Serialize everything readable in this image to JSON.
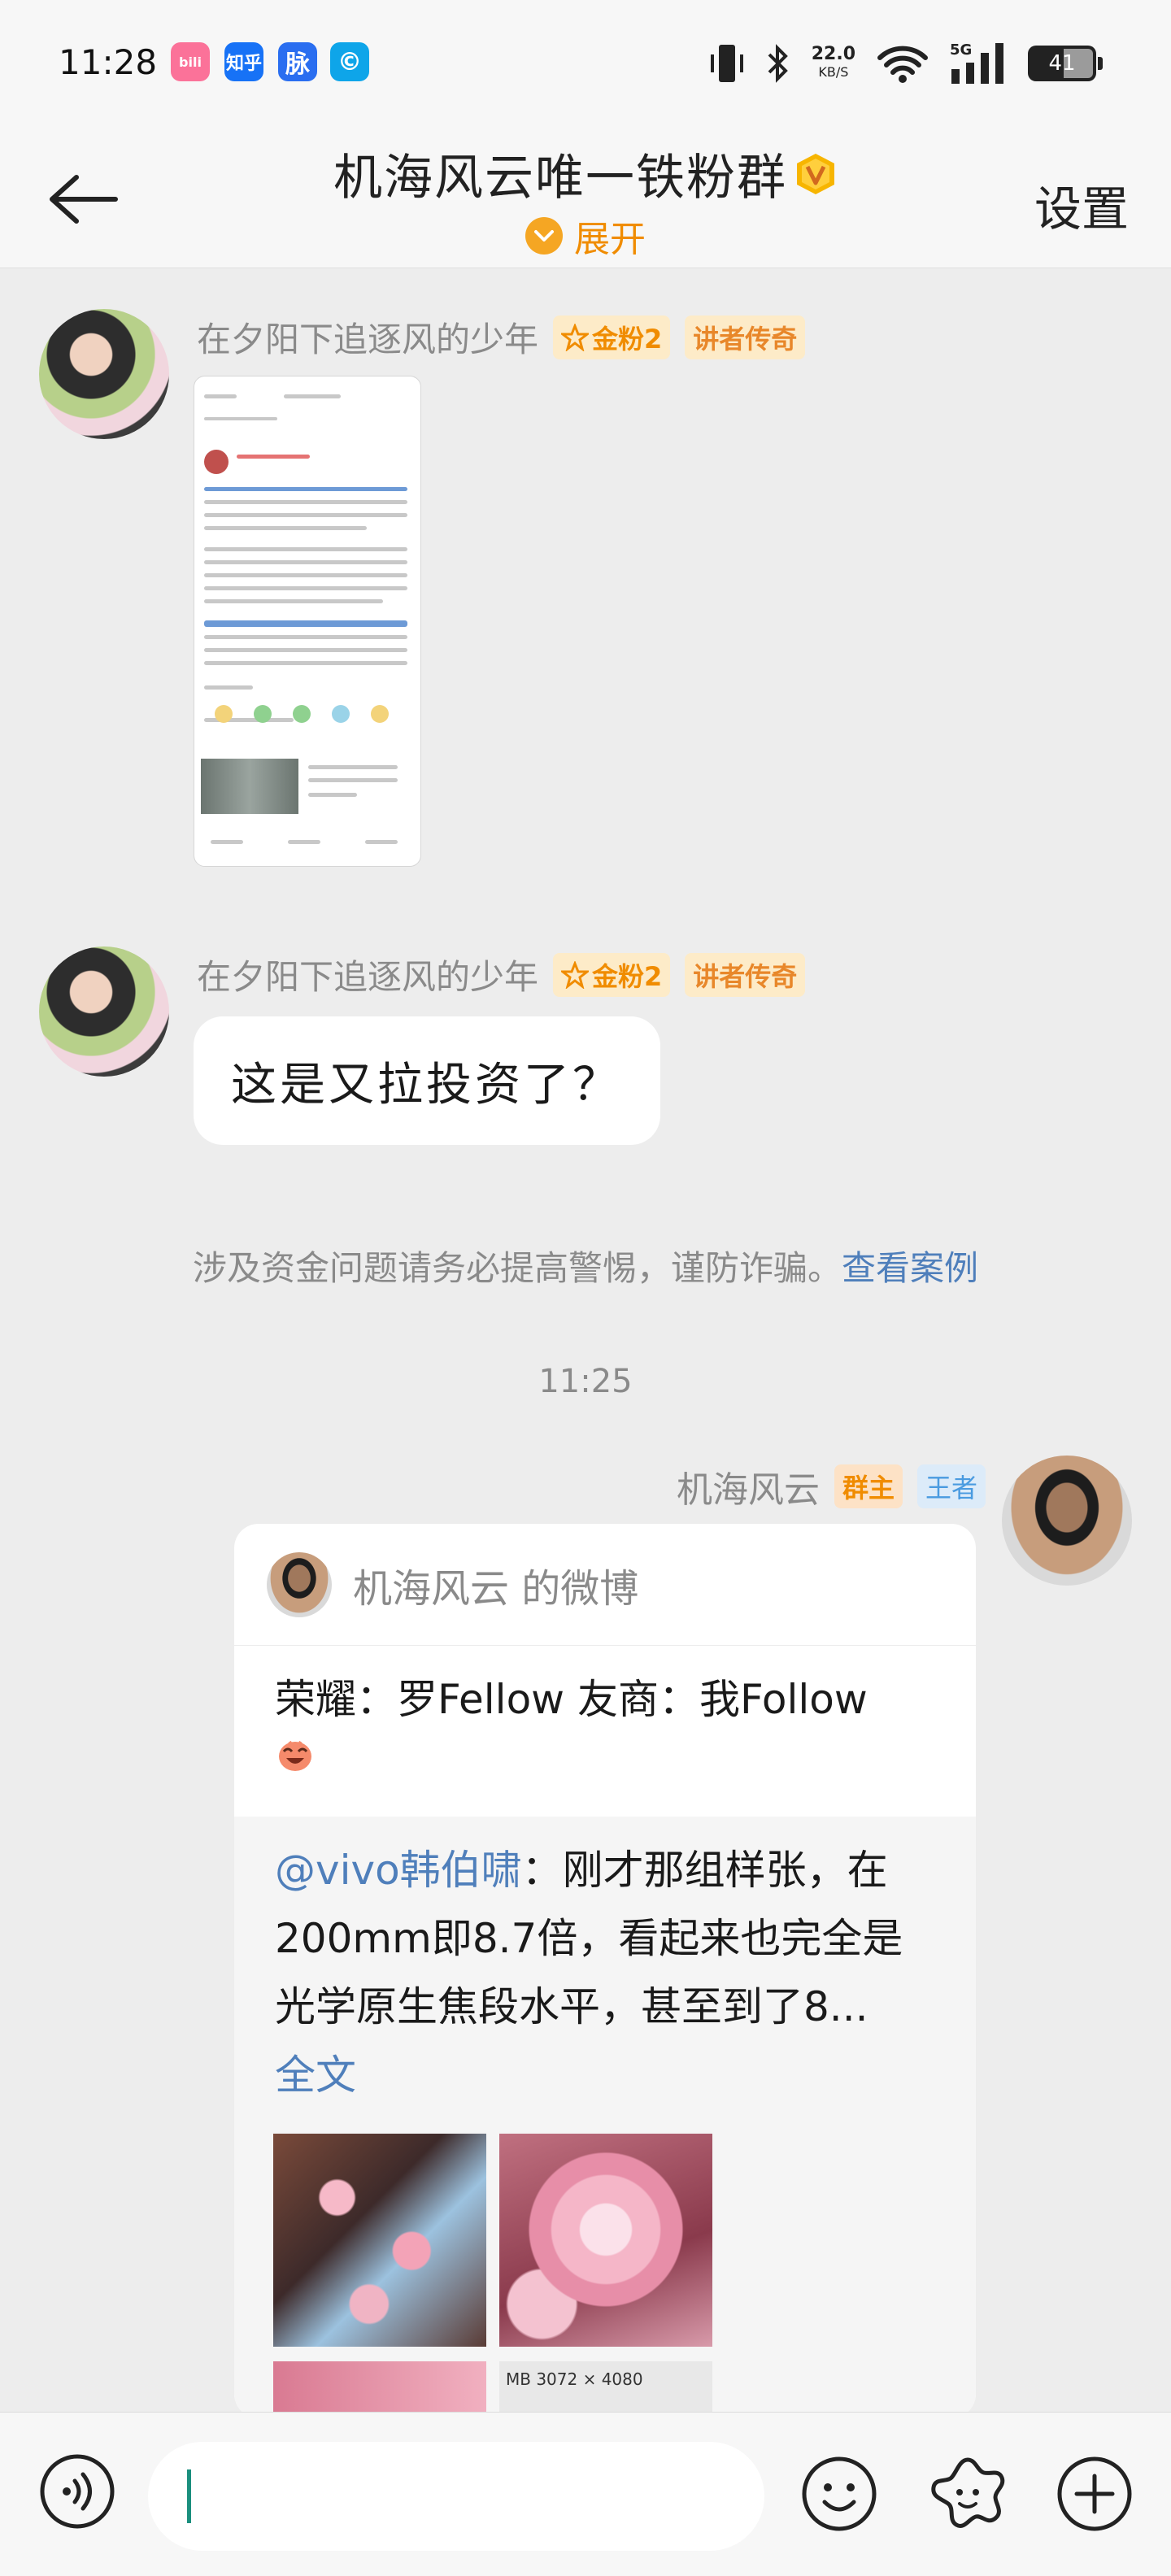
{
  "status_bar": {
    "time": "11:28",
    "apps": [
      {
        "name": "bilibili-icon",
        "label": "bilibili",
        "color": "#fb7299"
      },
      {
        "name": "zhihu-icon",
        "label": "知乎",
        "color": "#1772f6"
      },
      {
        "name": "maimai-icon",
        "label": "脉",
        "color": "#2a6ef0"
      },
      {
        "name": "app-c-icon",
        "label": "C",
        "color": "#0ea5e9"
      }
    ],
    "net_speed": "22.0",
    "net_unit": "KB/S",
    "network": "5G",
    "battery": "41",
    "battery_level": 0.41
  },
  "header": {
    "back_icon": "arrow-left-icon",
    "title": "机海风云唯一铁粉群",
    "expand_label": "展开",
    "settings_label": "设置"
  },
  "messages": [
    {
      "sender": "在夕阳下追逐风的少年",
      "fan_badge": "金粉2",
      "title_badge": "讲者传奇",
      "type": "image"
    },
    {
      "sender": "在夕阳下追逐风的少年",
      "fan_badge": "金粉2",
      "title_badge": "讲者传奇",
      "type": "text",
      "text": "这是又拉投资了？"
    }
  ],
  "notice": {
    "text": "涉及资金问题请务必提高警惕，谨防诈骗。",
    "link": "查看案例"
  },
  "timestamp": "11:25",
  "owner_message": {
    "sender": "机海风云",
    "role_badge": "群主",
    "level_badge": "王者",
    "card": {
      "header": "机海风云 的微博",
      "text": "荣耀：罗Fellow 友商：我Follow",
      "quote_mention": "@vivo韩伯啸",
      "quote_text": "：刚才那组样张，在200mm即8.7倍，看起来也完全是光学原生焦段水平，甚至到了8...",
      "quote_more": "全文",
      "image_meta": "MB  3072 × 4080"
    }
  },
  "input_bar": {
    "placeholder": "",
    "icons": [
      "voice-icon",
      "emoji-icon",
      "sticker-icon",
      "plus-icon"
    ]
  }
}
